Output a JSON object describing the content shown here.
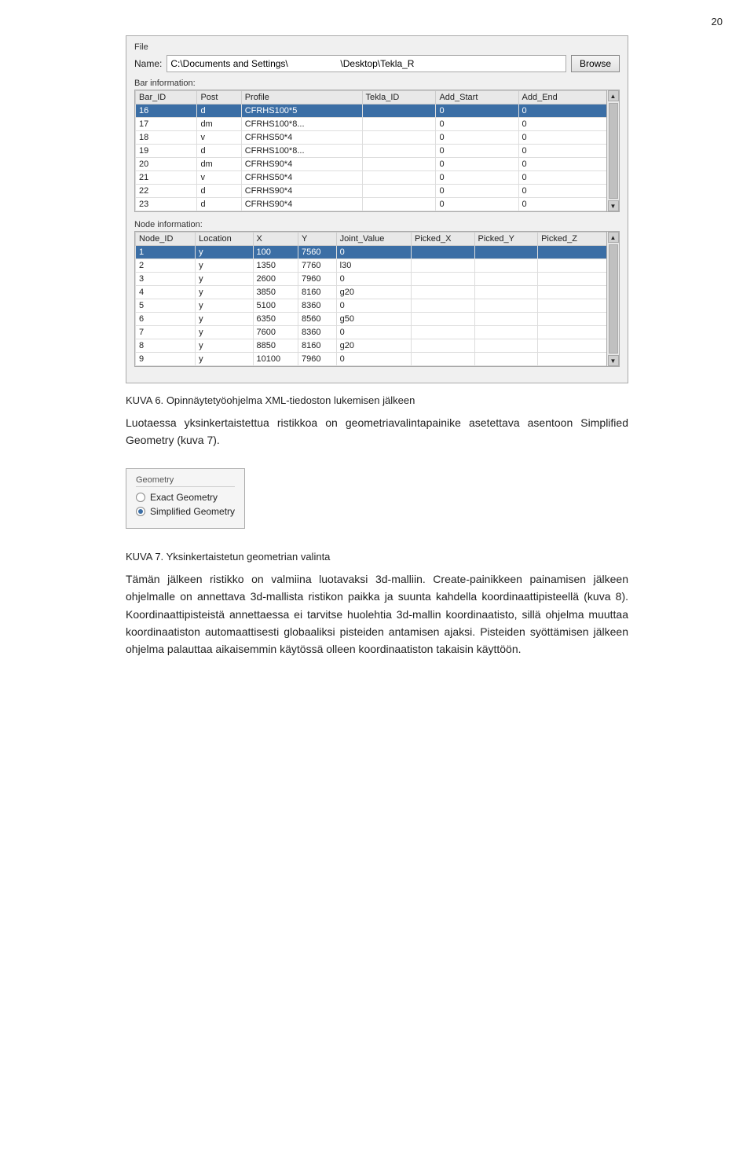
{
  "page": {
    "number": "20"
  },
  "dialog": {
    "file_section_label": "File",
    "name_label": "Name:",
    "file_path": "C:\\Documents and Settings\\                    \\Desktop\\Tekla_R",
    "browse_label": "Browse"
  },
  "bar_table": {
    "section_label": "Bar information:",
    "columns": [
      "Bar_ID",
      "Post",
      "Profile",
      "Tekla_ID",
      "Add_Start",
      "Add_End"
    ],
    "rows": [
      {
        "id": "16",
        "post": "d",
        "profile": "CFRHS100*5",
        "tekla_id": "",
        "add_start": "0",
        "add_end": "0",
        "selected": true
      },
      {
        "id": "17",
        "post": "dm",
        "profile": "CFRHS100*8...",
        "tekla_id": "",
        "add_start": "0",
        "add_end": "0",
        "selected": false
      },
      {
        "id": "18",
        "post": "v",
        "profile": "CFRHS50*4",
        "tekla_id": "",
        "add_start": "0",
        "add_end": "0",
        "selected": false
      },
      {
        "id": "19",
        "post": "d",
        "profile": "CFRHS100*8...",
        "tekla_id": "",
        "add_start": "0",
        "add_end": "0",
        "selected": false
      },
      {
        "id": "20",
        "post": "dm",
        "profile": "CFRHS90*4",
        "tekla_id": "",
        "add_start": "0",
        "add_end": "0",
        "selected": false
      },
      {
        "id": "21",
        "post": "v",
        "profile": "CFRHS50*4",
        "tekla_id": "",
        "add_start": "0",
        "add_end": "0",
        "selected": false
      },
      {
        "id": "22",
        "post": "d",
        "profile": "CFRHS90*4",
        "tekla_id": "",
        "add_start": "0",
        "add_end": "0",
        "selected": false
      },
      {
        "id": "23",
        "post": "d",
        "profile": "CFRHS90*4",
        "tekla_id": "",
        "add_start": "0",
        "add_end": "0",
        "selected": false
      }
    ]
  },
  "node_table": {
    "section_label": "Node information:",
    "columns": [
      "Node_ID",
      "Location",
      "X",
      "Y",
      "Joint_Value",
      "Picked_X",
      "Picked_Y",
      "Picked_Z"
    ],
    "rows": [
      {
        "node_id": "1",
        "location": "y",
        "x": "100",
        "y_val": "7560",
        "joint_value": "0",
        "picked_x": "",
        "picked_y": "",
        "picked_z": "",
        "selected": true
      },
      {
        "node_id": "2",
        "location": "y",
        "x": "1350",
        "y_val": "7760",
        "joint_value": "l30",
        "picked_x": "",
        "picked_y": "",
        "picked_z": "",
        "selected": false
      },
      {
        "node_id": "3",
        "location": "y",
        "x": "2600",
        "y_val": "7960",
        "joint_value": "0",
        "picked_x": "",
        "picked_y": "",
        "picked_z": "",
        "selected": false
      },
      {
        "node_id": "4",
        "location": "y",
        "x": "3850",
        "y_val": "8160",
        "joint_value": "g20",
        "picked_x": "",
        "picked_y": "",
        "picked_z": "",
        "selected": false
      },
      {
        "node_id": "5",
        "location": "y",
        "x": "5100",
        "y_val": "8360",
        "joint_value": "0",
        "picked_x": "",
        "picked_y": "",
        "picked_z": "",
        "selected": false
      },
      {
        "node_id": "6",
        "location": "y",
        "x": "6350",
        "y_val": "8560",
        "joint_value": "g50",
        "picked_x": "",
        "picked_y": "",
        "picked_z": "",
        "selected": false
      },
      {
        "node_id": "7",
        "location": "y",
        "x": "7600",
        "y_val": "8360",
        "joint_value": "0",
        "picked_x": "",
        "picked_y": "",
        "picked_z": "",
        "selected": false
      },
      {
        "node_id": "8",
        "location": "y",
        "x": "8850",
        "y_val": "8160",
        "joint_value": "g20",
        "picked_x": "",
        "picked_y": "",
        "picked_z": "",
        "selected": false
      },
      {
        "node_id": "9",
        "location": "y",
        "x": "10100",
        "y_val": "7960",
        "joint_value": "0",
        "picked_x": "",
        "picked_y": "",
        "picked_z": "",
        "selected": false
      }
    ]
  },
  "captions": {
    "figure6_label": "KUVA 6.",
    "figure6_text": "Opinnäytetyöohjelma XML-tiedoston lukemisen jälkeen",
    "paragraph1": "Luotaessa yksinkertaistettua ristikkoa on geometriavalintapainike asetettava asentoon Simplified Geometry (kuva 7).",
    "geometry_box_title": "Geometry",
    "exact_geometry_label": "Exact Geometry",
    "simplified_geometry_label": "Simplified Geometry",
    "figure7_label": "KUVA 7.",
    "figure7_text": "Yksinkertaistetun geometrian valinta",
    "paragraph2": "Tämän jälkeen ristikko on valmiina luotavaksi 3d-malliin. Create-painikkeen painamisen jälkeen ohjelmalle on annettava 3d-mallista ristikon paikka ja suunta kahdella koordinaattipisteellä (kuva 8). Koordinaattipisteistä annettaessa ei tarvitse huolehtia 3d-mallin koordinaatisto, sillä ohjelma muuttaa koordinaatiston automaattisesti globaaliksi pisteiden antamisen ajaksi. Pisteiden syöttämisen jälkeen ohjelma palauttaa aikaisemmin käytössä olleen koordinaatiston takaisin käyttöön."
  }
}
